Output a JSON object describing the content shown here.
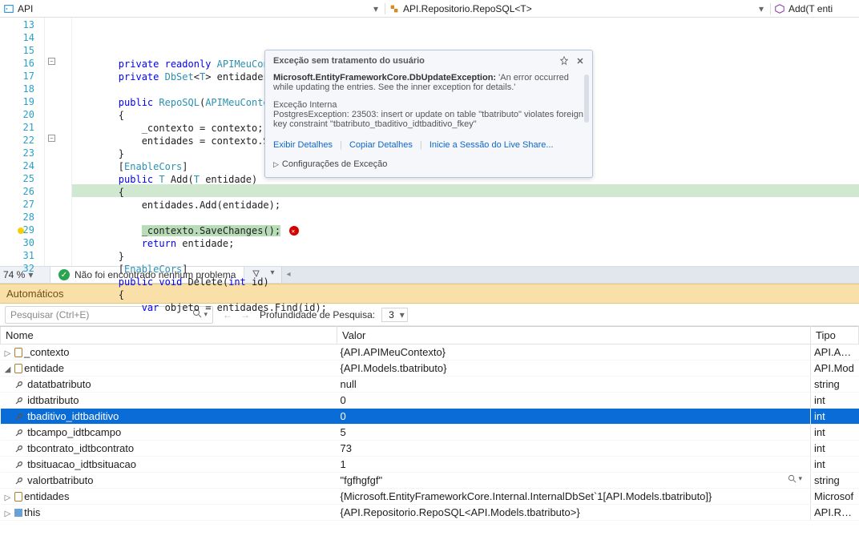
{
  "breadcrumbs": {
    "left": "API",
    "middle": "API.Repositorio.RepoSQL<T>",
    "right": "Add(T enti"
  },
  "code": {
    "lines": [
      {
        "n": 13,
        "t": "        private readonly APIMeuContexto _contexto;"
      },
      {
        "n": 14,
        "t": "        private DbSet<T> entidades;"
      },
      {
        "n": 15,
        "t": ""
      },
      {
        "n": 16,
        "t": "        public RepoSQL(APIMeuContexto"
      },
      {
        "n": 17,
        "t": "        {"
      },
      {
        "n": 18,
        "t": "            _contexto = contexto;"
      },
      {
        "n": 19,
        "t": "            entidades = contexto.Set"
      },
      {
        "n": 20,
        "t": "        }"
      },
      {
        "n": 21,
        "t": "        [EnableCors]"
      },
      {
        "n": 22,
        "t": "        public T Add(T entidade)"
      },
      {
        "n": 23,
        "t": "        {"
      },
      {
        "n": 24,
        "t": "            entidades.Add(entidade);"
      },
      {
        "n": 25,
        "t": ""
      },
      {
        "n": 26,
        "t": "            _contexto.SaveChanges();"
      },
      {
        "n": 27,
        "t": "            return entidade;"
      },
      {
        "n": 28,
        "t": "        }"
      },
      {
        "n": 29,
        "t": "        [EnableCors]"
      },
      {
        "n": 30,
        "t": "        public void Delete(int id)"
      },
      {
        "n": 31,
        "t": "        {"
      },
      {
        "n": 32,
        "t": "            var objeto = entidades.Find(id);"
      }
    ],
    "highlighted_line": 26
  },
  "exception": {
    "title": "Exceção sem tratamento do usuário",
    "bold": "Microsoft.EntityFrameworkCore.DbUpdateException:",
    "msg": "'An error occurred while updating the entries. See the inner exception for details.'",
    "sub_title": "Exceção Interna",
    "sub_msg": "PostgresException: 23503: insert or update on table \"tbatributo\" violates foreign key constraint \"tbatributo_tbaditivo_idtbaditivo_fkey\"",
    "links": {
      "a": "Exibir Detalhes",
      "b": "Copiar Detalhes",
      "c": "Inicie a Sessão do Live Share..."
    },
    "footer": "Configurações de Exceção"
  },
  "status": {
    "zoom": "74 %",
    "ok": "Não foi encontrado nenhum problema"
  },
  "panel": {
    "title": "Automáticos",
    "search_placeholder": "Pesquisar (Ctrl+E)",
    "depth_label": "Profundidade de Pesquisa:",
    "depth_value": "3",
    "headers": {
      "name": "Nome",
      "value": "Valor",
      "type": "Tipo"
    },
    "rows": [
      {
        "l": 0,
        "exp": "▷",
        "icon": "lock",
        "name": "_contexto",
        "value": "{API.APIMeuContexto}",
        "type": "API.APIM"
      },
      {
        "l": 0,
        "exp": "◢",
        "icon": "lock",
        "name": "entidade",
        "value": "{API.Models.tbatributo}",
        "type": "API.Mod"
      },
      {
        "l": 1,
        "exp": "",
        "icon": "wrench",
        "name": "datatbatributo",
        "value": "null",
        "type": "string"
      },
      {
        "l": 1,
        "exp": "",
        "icon": "wrench",
        "name": "idtbatributo",
        "value": "0",
        "type": "int"
      },
      {
        "l": 1,
        "exp": "",
        "icon": "wrench",
        "name": "tbaditivo_idtbaditivo",
        "value": "0",
        "type": "int",
        "sel": true,
        "dotted": true
      },
      {
        "l": 1,
        "exp": "",
        "icon": "wrench",
        "name": "tbcampo_idtbcampo",
        "value": "5",
        "type": "int"
      },
      {
        "l": 1,
        "exp": "",
        "icon": "wrench",
        "name": "tbcontrato_idtbcontrato",
        "value": "73",
        "type": "int"
      },
      {
        "l": 1,
        "exp": "",
        "icon": "wrench",
        "name": "tbsituacao_idtbsituacao",
        "value": "1",
        "type": "int"
      },
      {
        "l": 1,
        "exp": "",
        "icon": "wrench",
        "name": "valortbatributo",
        "value": "\"fgfhgfgf\"",
        "type": "string",
        "mag": true
      },
      {
        "l": 0,
        "exp": "▷",
        "icon": "lock",
        "name": "entidades",
        "value": "{Microsoft.EntityFrameworkCore.Internal.InternalDbSet`1[API.Models.tbatributo]}",
        "type": "Microsof"
      },
      {
        "l": 0,
        "exp": "▷",
        "icon": "cube",
        "name": "this",
        "value": "{API.Repositorio.RepoSQL<API.Models.tbatributo>}",
        "type": "API.Repo"
      }
    ]
  }
}
